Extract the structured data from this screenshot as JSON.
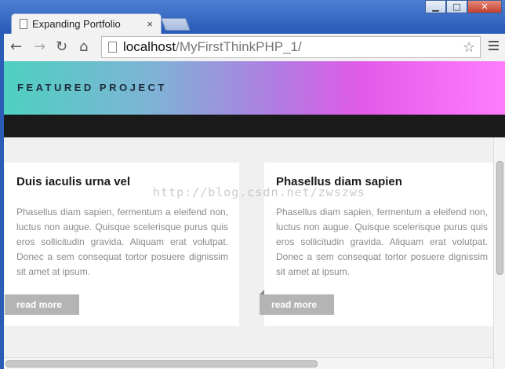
{
  "browser": {
    "tab_title": "Expanding Portfolio",
    "tab_close": "×",
    "url_host": "localhost",
    "url_path": "/MyFirstThinkPHP_1/",
    "icons": [
      "page-icon",
      "back-icon",
      "forward-icon",
      "reload-icon",
      "home-icon",
      "bookmark-star-icon",
      "menu-icon"
    ]
  },
  "page": {
    "hero_title": "FEATURED PROJECT",
    "watermark": "http://blog.csdn.net/zwszws",
    "cards": [
      {
        "title": "Duis iaculis urna vel",
        "body": "Phasellus diam sapien, fermentum a eleifend non, luctus non augue. Quisque scelerisque purus quis eros sollicitudin gravida. Aliquam erat volutpat. Donec a sem consequat tortor posuere dignissim sit amet at ipsum.",
        "button": "read more"
      },
      {
        "title": "Phasellus diam sapien",
        "body": "Phasellus diam sapien, fermentum a eleifend non, luctus non augue. Quisque scelerisque purus quis eros sollicitudin gravida. Aliquam erat volutpat. Donec a sem consequat tortor posuere dignissim sit amet at ipsum.",
        "button": "read more"
      }
    ]
  },
  "colors": {
    "hero_gradient": [
      "#4ed0c0",
      "#b27ae2",
      "#ff7cff"
    ],
    "dark_bar": "#1a1a1a",
    "button": "#b4b4b4"
  }
}
